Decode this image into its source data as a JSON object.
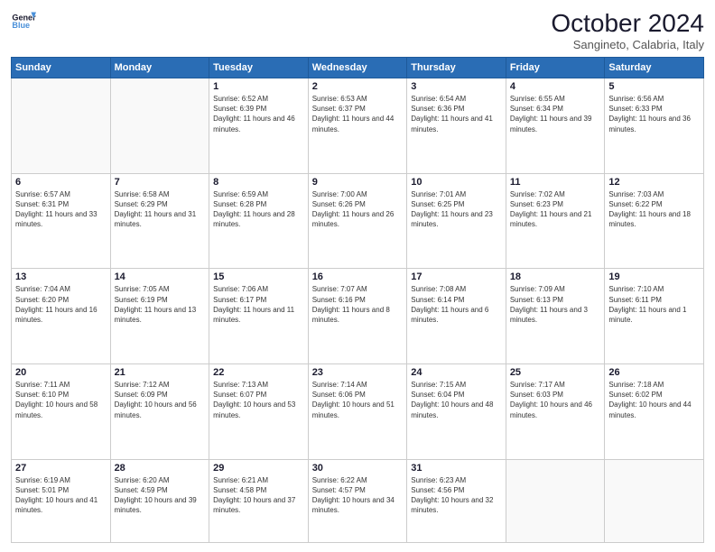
{
  "header": {
    "logo_line1": "General",
    "logo_line2": "Blue",
    "month": "October 2024",
    "location": "Sangineto, Calabria, Italy"
  },
  "weekdays": [
    "Sunday",
    "Monday",
    "Tuesday",
    "Wednesday",
    "Thursday",
    "Friday",
    "Saturday"
  ],
  "weeks": [
    [
      {
        "day": "",
        "info": ""
      },
      {
        "day": "",
        "info": ""
      },
      {
        "day": "1",
        "info": "Sunrise: 6:52 AM\nSunset: 6:39 PM\nDaylight: 11 hours and 46 minutes."
      },
      {
        "day": "2",
        "info": "Sunrise: 6:53 AM\nSunset: 6:37 PM\nDaylight: 11 hours and 44 minutes."
      },
      {
        "day": "3",
        "info": "Sunrise: 6:54 AM\nSunset: 6:36 PM\nDaylight: 11 hours and 41 minutes."
      },
      {
        "day": "4",
        "info": "Sunrise: 6:55 AM\nSunset: 6:34 PM\nDaylight: 11 hours and 39 minutes."
      },
      {
        "day": "5",
        "info": "Sunrise: 6:56 AM\nSunset: 6:33 PM\nDaylight: 11 hours and 36 minutes."
      }
    ],
    [
      {
        "day": "6",
        "info": "Sunrise: 6:57 AM\nSunset: 6:31 PM\nDaylight: 11 hours and 33 minutes."
      },
      {
        "day": "7",
        "info": "Sunrise: 6:58 AM\nSunset: 6:29 PM\nDaylight: 11 hours and 31 minutes."
      },
      {
        "day": "8",
        "info": "Sunrise: 6:59 AM\nSunset: 6:28 PM\nDaylight: 11 hours and 28 minutes."
      },
      {
        "day": "9",
        "info": "Sunrise: 7:00 AM\nSunset: 6:26 PM\nDaylight: 11 hours and 26 minutes."
      },
      {
        "day": "10",
        "info": "Sunrise: 7:01 AM\nSunset: 6:25 PM\nDaylight: 11 hours and 23 minutes."
      },
      {
        "day": "11",
        "info": "Sunrise: 7:02 AM\nSunset: 6:23 PM\nDaylight: 11 hours and 21 minutes."
      },
      {
        "day": "12",
        "info": "Sunrise: 7:03 AM\nSunset: 6:22 PM\nDaylight: 11 hours and 18 minutes."
      }
    ],
    [
      {
        "day": "13",
        "info": "Sunrise: 7:04 AM\nSunset: 6:20 PM\nDaylight: 11 hours and 16 minutes."
      },
      {
        "day": "14",
        "info": "Sunrise: 7:05 AM\nSunset: 6:19 PM\nDaylight: 11 hours and 13 minutes."
      },
      {
        "day": "15",
        "info": "Sunrise: 7:06 AM\nSunset: 6:17 PM\nDaylight: 11 hours and 11 minutes."
      },
      {
        "day": "16",
        "info": "Sunrise: 7:07 AM\nSunset: 6:16 PM\nDaylight: 11 hours and 8 minutes."
      },
      {
        "day": "17",
        "info": "Sunrise: 7:08 AM\nSunset: 6:14 PM\nDaylight: 11 hours and 6 minutes."
      },
      {
        "day": "18",
        "info": "Sunrise: 7:09 AM\nSunset: 6:13 PM\nDaylight: 11 hours and 3 minutes."
      },
      {
        "day": "19",
        "info": "Sunrise: 7:10 AM\nSunset: 6:11 PM\nDaylight: 11 hours and 1 minute."
      }
    ],
    [
      {
        "day": "20",
        "info": "Sunrise: 7:11 AM\nSunset: 6:10 PM\nDaylight: 10 hours and 58 minutes."
      },
      {
        "day": "21",
        "info": "Sunrise: 7:12 AM\nSunset: 6:09 PM\nDaylight: 10 hours and 56 minutes."
      },
      {
        "day": "22",
        "info": "Sunrise: 7:13 AM\nSunset: 6:07 PM\nDaylight: 10 hours and 53 minutes."
      },
      {
        "day": "23",
        "info": "Sunrise: 7:14 AM\nSunset: 6:06 PM\nDaylight: 10 hours and 51 minutes."
      },
      {
        "day": "24",
        "info": "Sunrise: 7:15 AM\nSunset: 6:04 PM\nDaylight: 10 hours and 48 minutes."
      },
      {
        "day": "25",
        "info": "Sunrise: 7:17 AM\nSunset: 6:03 PM\nDaylight: 10 hours and 46 minutes."
      },
      {
        "day": "26",
        "info": "Sunrise: 7:18 AM\nSunset: 6:02 PM\nDaylight: 10 hours and 44 minutes."
      }
    ],
    [
      {
        "day": "27",
        "info": "Sunrise: 6:19 AM\nSunset: 5:01 PM\nDaylight: 10 hours and 41 minutes."
      },
      {
        "day": "28",
        "info": "Sunrise: 6:20 AM\nSunset: 4:59 PM\nDaylight: 10 hours and 39 minutes."
      },
      {
        "day": "29",
        "info": "Sunrise: 6:21 AM\nSunset: 4:58 PM\nDaylight: 10 hours and 37 minutes."
      },
      {
        "day": "30",
        "info": "Sunrise: 6:22 AM\nSunset: 4:57 PM\nDaylight: 10 hours and 34 minutes."
      },
      {
        "day": "31",
        "info": "Sunrise: 6:23 AM\nSunset: 4:56 PM\nDaylight: 10 hours and 32 minutes."
      },
      {
        "day": "",
        "info": ""
      },
      {
        "day": "",
        "info": ""
      }
    ]
  ]
}
